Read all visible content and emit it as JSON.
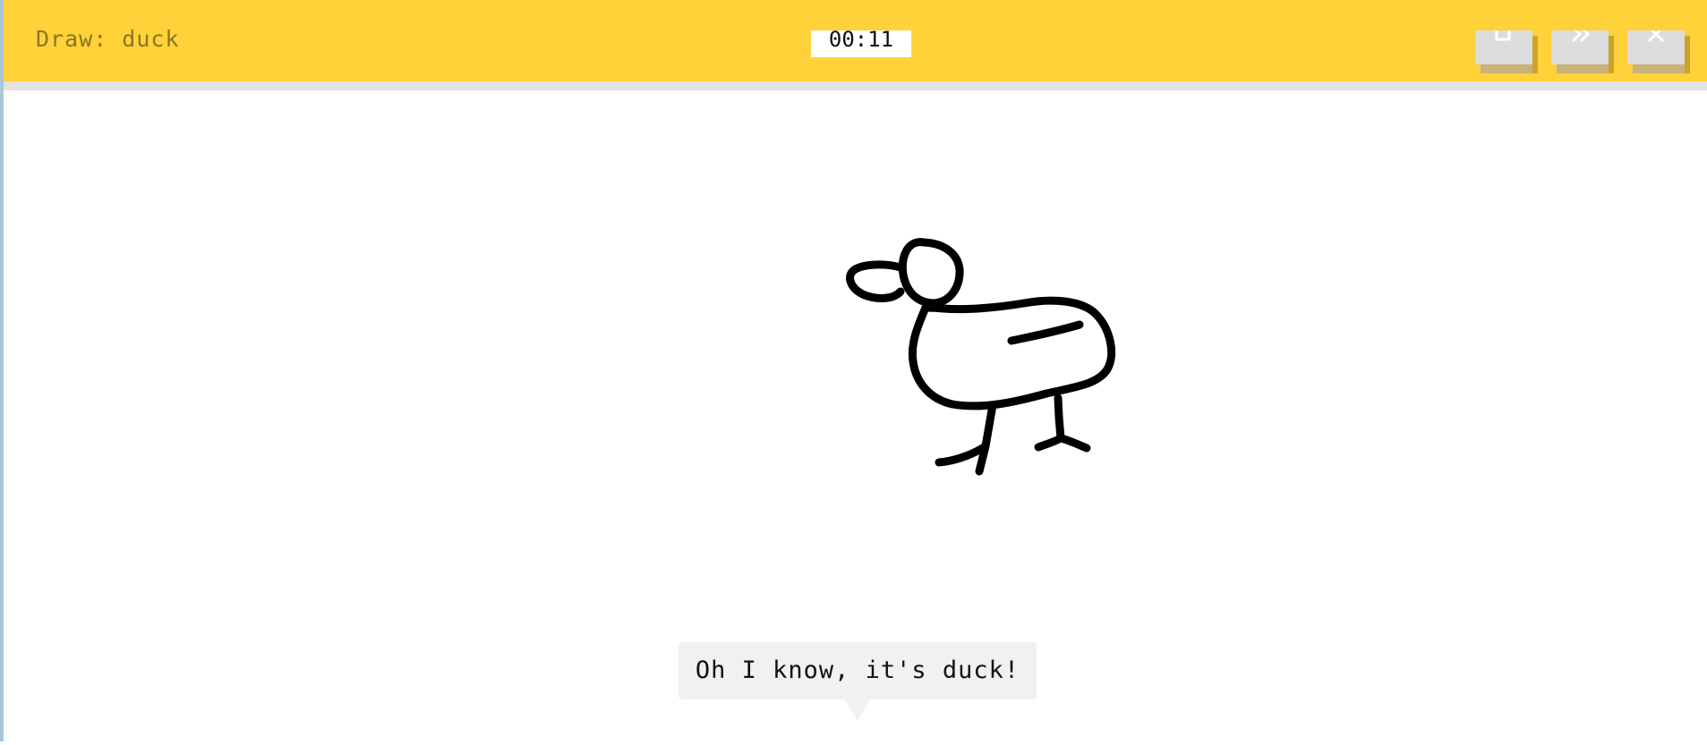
{
  "header": {
    "prompt": "Draw: duck",
    "timer": "00:11",
    "background_color": "#ffd23a",
    "buttons": [
      {
        "name": "clear-button",
        "icon": "clear-icon"
      },
      {
        "name": "skip-button",
        "icon": "skip-icon"
      },
      {
        "name": "close-button",
        "icon": "close-icon"
      }
    ]
  },
  "canvas": {
    "stroke_color": "#000000"
  },
  "guess_bubble": {
    "text": "Oh I know, it's duck!"
  }
}
